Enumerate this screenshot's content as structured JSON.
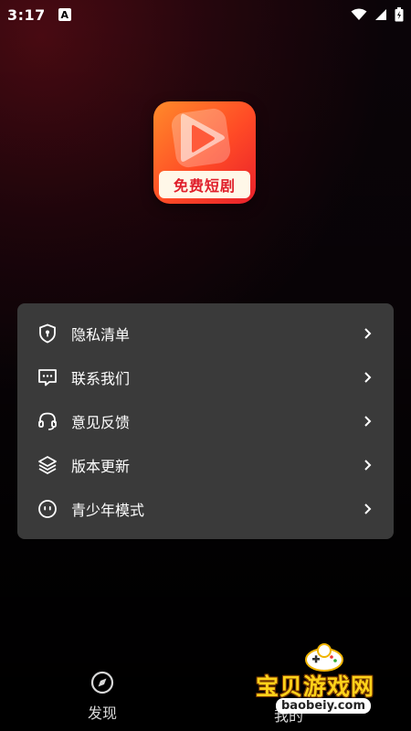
{
  "status_bar": {
    "time": "3:17",
    "notification_icon": "A"
  },
  "app_logo": {
    "banner_text": "免费短剧",
    "colors": {
      "gradient_start": "#ff8a2a",
      "gradient_end": "#e8202b",
      "banner_text": "#e01e2a"
    }
  },
  "menu": {
    "items": [
      {
        "label": "隐私清单",
        "icon": "shield-lock-icon"
      },
      {
        "label": "联系我们",
        "icon": "chat-bubble-icon"
      },
      {
        "label": "意见反馈",
        "icon": "headset-icon"
      },
      {
        "label": "版本更新",
        "icon": "layers-icon"
      },
      {
        "label": "青少年模式",
        "icon": "face-icon"
      }
    ],
    "background": "#3a3a3a"
  },
  "bottom_nav": {
    "discover_label": "发现",
    "partially_hidden_label": "我的"
  },
  "watermark": {
    "title": "宝贝游戏网",
    "url": "baobeiy.com"
  }
}
